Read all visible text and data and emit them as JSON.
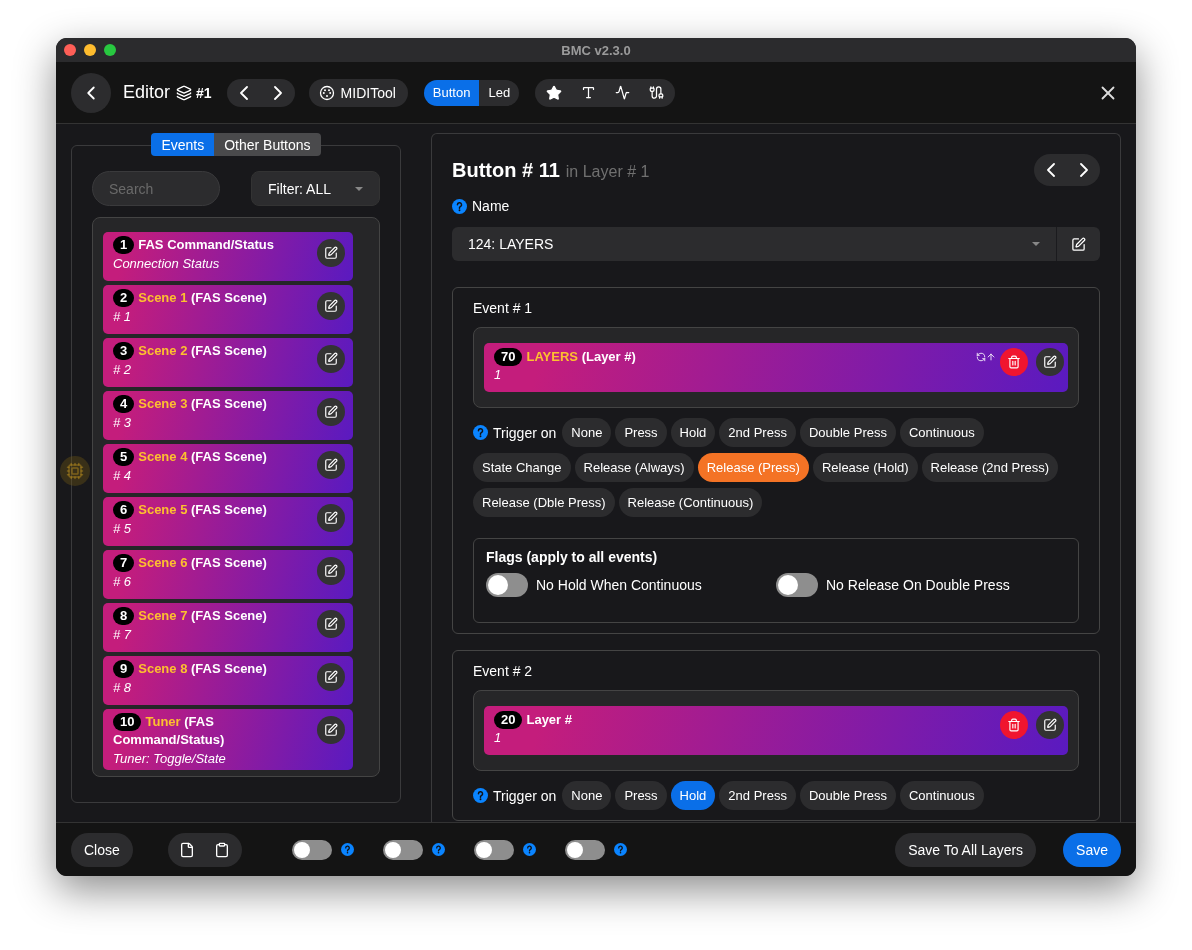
{
  "window": {
    "title": "BMC v2.3.0"
  },
  "toolbar": {
    "title": "Editor",
    "layer": "#1",
    "midi_tool": "MIDITool",
    "mode_tabs": [
      {
        "label": "Button",
        "selected": true
      },
      {
        "label": "Led",
        "selected": false
      }
    ]
  },
  "left_panel": {
    "tabs": [
      {
        "label": "Events",
        "selected": true
      },
      {
        "label": "Other Buttons",
        "selected": false
      }
    ],
    "search": {
      "placeholder": "Search"
    },
    "filter": "Filter: ALL",
    "events": [
      {
        "number": "1",
        "type": "FAS Command/Status",
        "subtitle": "Connection Status"
      },
      {
        "number": "2",
        "name": "Scene 1",
        "type": "(FAS Scene)",
        "subtitle": "# 1"
      },
      {
        "number": "3",
        "name": "Scene 2",
        "type": "(FAS Scene)",
        "subtitle": "# 2"
      },
      {
        "number": "4",
        "name": "Scene 3",
        "type": "(FAS Scene)",
        "subtitle": "# 3"
      },
      {
        "number": "5",
        "name": "Scene 4",
        "type": "(FAS Scene)",
        "subtitle": "# 4"
      },
      {
        "number": "6",
        "name": "Scene 5",
        "type": "(FAS Scene)",
        "subtitle": "# 5"
      },
      {
        "number": "7",
        "name": "Scene 6",
        "type": "(FAS Scene)",
        "subtitle": "# 6"
      },
      {
        "number": "8",
        "name": "Scene 7",
        "type": "(FAS Scene)",
        "subtitle": "# 7"
      },
      {
        "number": "9",
        "name": "Scene 8",
        "type": "(FAS Scene)",
        "subtitle": "# 8"
      },
      {
        "number": "10",
        "name": "Tuner",
        "type": "(FAS Command/Status)",
        "subtitle": "Tuner: Toggle/State"
      }
    ]
  },
  "editor": {
    "heading": "Button # 11",
    "subheading": "in Layer # 1",
    "name_label": "Name",
    "name_value": "124: LAYERS",
    "events": [
      {
        "title": "Event # 1",
        "item": {
          "number": "70",
          "name": "LAYERS",
          "type": "(Layer #)",
          "value": "1",
          "sync": true
        },
        "trigger_label": "Trigger on",
        "color": "#f47325",
        "triggers": [
          {
            "label": "None",
            "selected": false
          },
          {
            "label": "Press",
            "selected": false
          },
          {
            "label": "Hold",
            "selected": false
          },
          {
            "label": "2nd Press",
            "selected": false
          },
          {
            "label": "Double Press",
            "selected": false
          },
          {
            "label": "Continuous",
            "selected": false
          },
          {
            "label": "State Change",
            "selected": false
          },
          {
            "label": "Release (Always)",
            "selected": false
          },
          {
            "label": "Release (Press)",
            "selected": true
          },
          {
            "label": "Release (Hold)",
            "selected": false
          },
          {
            "label": "Release (2nd Press)",
            "selected": false
          },
          {
            "label": "Release (Dble Press)",
            "selected": false
          },
          {
            "label": "Release (Continuous)",
            "selected": false
          }
        ],
        "flags": {
          "title": "Flags (apply to all events)",
          "items": [
            {
              "label": "No Hold When Continuous",
              "on": false
            },
            {
              "label": "No Release On Double Press",
              "on": false
            }
          ]
        }
      },
      {
        "title": "Event # 2",
        "item": {
          "number": "20",
          "type": "Layer #",
          "value": "1",
          "sync": false
        },
        "trigger_label": "Trigger on",
        "color": "#0a6fe8",
        "triggers": [
          {
            "label": "None",
            "selected": false
          },
          {
            "label": "Press",
            "selected": false
          },
          {
            "label": "Hold",
            "selected": true
          },
          {
            "label": "2nd Press",
            "selected": false
          },
          {
            "label": "Double Press",
            "selected": false
          },
          {
            "label": "Continuous",
            "selected": false
          }
        ]
      }
    ]
  },
  "footer": {
    "close": "Close",
    "toggles": [
      {
        "on": false
      },
      {
        "on": false
      },
      {
        "on": false
      },
      {
        "on": false
      }
    ],
    "save_all": "Save To All Layers",
    "save": "Save"
  }
}
